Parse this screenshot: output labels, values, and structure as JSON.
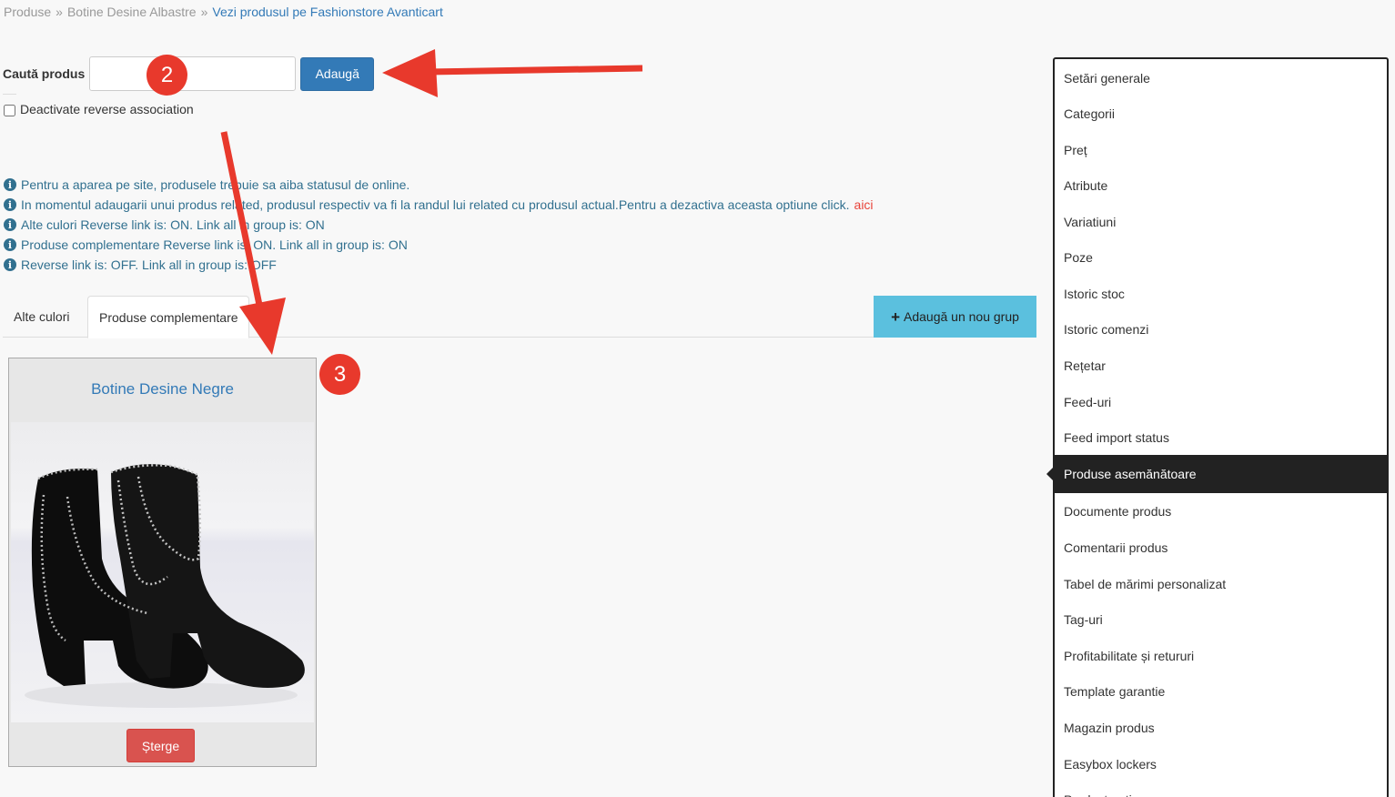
{
  "breadcrumb": {
    "items": [
      "Produse",
      "Botine Desine Albastre"
    ],
    "separator": "»",
    "link": "Vezi produsul pe Fashionstore Avanticart"
  },
  "search": {
    "label": "Caută produs",
    "placeholder": "",
    "add_button": "Adaugă"
  },
  "reverse_checkbox": {
    "label": "Deactivate reverse association",
    "checked": false
  },
  "info": {
    "icon": "info-circle-icon",
    "lines": [
      "Pentru a aparea pe site, produsele trebuie sa aiba statusul de online.",
      "In momentul adaugarii unui produs related, produsul respectiv va fi la randul lui related cu produsul actual.Pentru a dezactiva aceasta optiune click.",
      "Alte culori Reverse link is: ON. Link all in group is: ON",
      "Produse complementare Reverse link is: ON. Link all in group is: ON",
      "Reverse link is: OFF. Link all in group is: OFF"
    ],
    "link_text": "aici"
  },
  "tabs": [
    {
      "label": "Alte culori",
      "active": false
    },
    {
      "label": "Produse complementare",
      "active": true
    }
  ],
  "add_group_button": {
    "label": "Adaugă un nou grup",
    "icon": "plus-icon"
  },
  "product_card": {
    "title": "Botine Desine Negre",
    "delete_label": "Șterge"
  },
  "side_menu": {
    "items": [
      "Setări generale",
      "Categorii",
      "Preț",
      "Atribute",
      "Variatiuni",
      "Poze",
      "Istoric stoc",
      "Istoric comenzi",
      "Rețetar",
      "Feed-uri",
      "Feed import status",
      "Produse asemănătoare",
      "Documente produs",
      "Comentarii produs",
      "Tabel de mărimi personalizat",
      "Tag-uri",
      "Profitabilitate și retururi",
      "Template garantie",
      "Magazin produs",
      "Easybox lockers",
      "Product options"
    ],
    "active_index": 11
  },
  "annotations": {
    "badge_2": "2",
    "badge_3": "3",
    "color": "#e8392c"
  }
}
